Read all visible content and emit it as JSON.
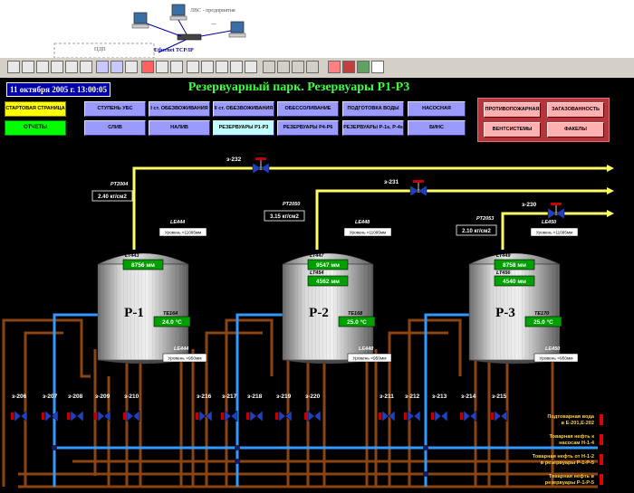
{
  "network": {
    "lan_label": "ЛВС - предприятия",
    "dots": "...",
    "ethernet_label": "Ethernet TCP/IP",
    "pdu_label": "ПДП"
  },
  "header": {
    "datetime": "11 октября 2005 г. 13:00:05",
    "title": "Резервуарный парк. Резервуары Р1-Р3"
  },
  "nav": {
    "start_page": "СТАРТОВАЯ СТРАНИЦА",
    "reports": "ОТЧЕТЫ",
    "row1": [
      "СТУПЕНЬ УБС",
      "I ст. ОБЕЗВОЖИВАНИЯ",
      "II ст. ОБЕЗВОЖИВАНИЯ",
      "ОБЕССОЛИВАНИЕ",
      "ПОДГОТОВКА ВОДЫ",
      "НАСОСНАЯ"
    ],
    "row2": [
      "СЛИВ",
      "НАЛИВ",
      "РЕЗЕРВУАРЫ Р1-Р3",
      "РЕЗЕРВУАРЫ Р4-Р6",
      "РЕЗЕРВУАРЫ Р-1s, Р-4s",
      "БИНС"
    ],
    "active": "РЕЗЕРВУАРЫ Р1-Р3",
    "safety": [
      "ПРОТИВОПОЖАРНАЯ",
      "ЗАГАЗОВАННОСТЬ",
      "ВЕНТСИСТЕМЫ",
      "ФАКЕЛЫ"
    ]
  },
  "pressure": [
    {
      "tag": "PT2004",
      "value": "2.40 кг/см2"
    },
    {
      "tag": "PT2050",
      "value": "3.15 кг/см2"
    },
    {
      "tag": "PT2053",
      "value": "2.10 кг/см2"
    }
  ],
  "valves_top": [
    "з-232",
    "з-231",
    "з-230"
  ],
  "tanks": [
    {
      "name": "Р-1",
      "le_top": "LE444",
      "high_level": "Уровень >11095мм",
      "lt1_tag": "LT443",
      "lt1": "8756 мм",
      "te_tag": "TE164",
      "temp": "24.0 °С",
      "le_bottom": "LE444",
      "low_level": "Уровень <950мм"
    },
    {
      "name": "Р-2",
      "le_top": "LE448",
      "high_level": "Уровень >11095мм",
      "lt1_tag": "LT447",
      "lt1": "9547 мм",
      "lt2_tag": "LT454",
      "lt2": "4562 мм",
      "te_tag": "TE168",
      "temp": "25.0 °С",
      "le_bottom": "LE448",
      "low_level": "Уровень <950мм"
    },
    {
      "name": "Р-3",
      "le_top": "LE450",
      "high_level": "Уровень >11095мм",
      "lt1_tag": "LT449",
      "lt1": "8758 мм",
      "lt2_tag": "LT456",
      "lt2": "4540 мм",
      "te_tag": "TE170",
      "temp": "25.0 °С",
      "le_bottom": "LE450",
      "low_level": "Уровень <950мм"
    }
  ],
  "valves_bottom": [
    "з-206",
    "з-207",
    "з-208",
    "з-209",
    "з-210",
    "з-216",
    "з-217",
    "з-218",
    "з-219",
    "з-220",
    "з-211",
    "з-212",
    "з-213",
    "з-214",
    "з-215"
  ],
  "outlets": [
    "Подтоварная вода в Е-201,Е-202",
    "Товарная нефть к насосам Н-1-4",
    "Товарная нефть от Н-1-2 в резервуары Р-1-Р-5",
    "Товарная нефть в резервуары Р-1-Р-5"
  ],
  "colors": {
    "background": "#000000",
    "gas_pipe": "#ffff66",
    "water_pipe": "#3399ff",
    "oil_pipe": "#8b4513",
    "valve": "#2040c0",
    "value_box": "#00a000",
    "title": "#3cff3c"
  }
}
